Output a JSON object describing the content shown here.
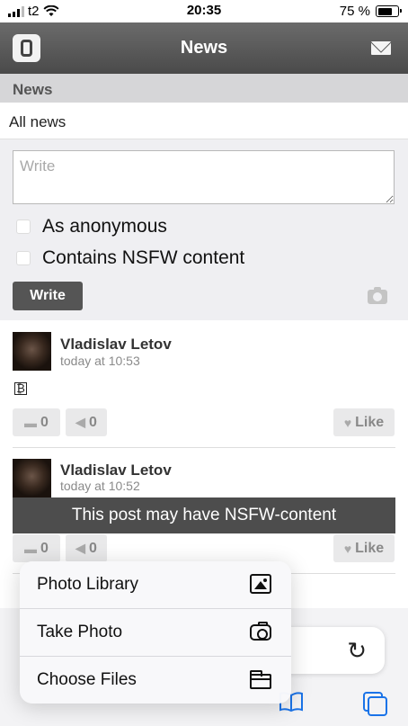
{
  "status_bar": {
    "carrier": "t2",
    "time": "20:35",
    "battery": "75 %",
    "battery_level": 0.75
  },
  "header": {
    "title": "News"
  },
  "section": {
    "title": "News"
  },
  "filter": {
    "label": "All news"
  },
  "composer": {
    "placeholder": "Write",
    "anonymous_label": "As anonymous",
    "nsfw_label": "Contains NSFW content",
    "submit_label": "Write"
  },
  "posts": [
    {
      "author": "Vladislav Letov",
      "time": "today at 10:53",
      "body": "₿",
      "comments": "0",
      "reposts": "0",
      "like_label": "Like"
    },
    {
      "author": "Vladislav Letov",
      "time": "today at 10:52",
      "comments": "0",
      "reposts": "0",
      "like_label": "Like",
      "nsfw_notice": "This post may have NSFW-content"
    }
  ],
  "action_sheet": {
    "items": [
      {
        "label": "Photo Library",
        "icon": "photo-library-icon"
      },
      {
        "label": "Take Photo",
        "icon": "camera-icon"
      },
      {
        "label": "Choose Files",
        "icon": "folder-icon"
      }
    ]
  },
  "browser": {
    "reload_icon": "reload-icon"
  }
}
